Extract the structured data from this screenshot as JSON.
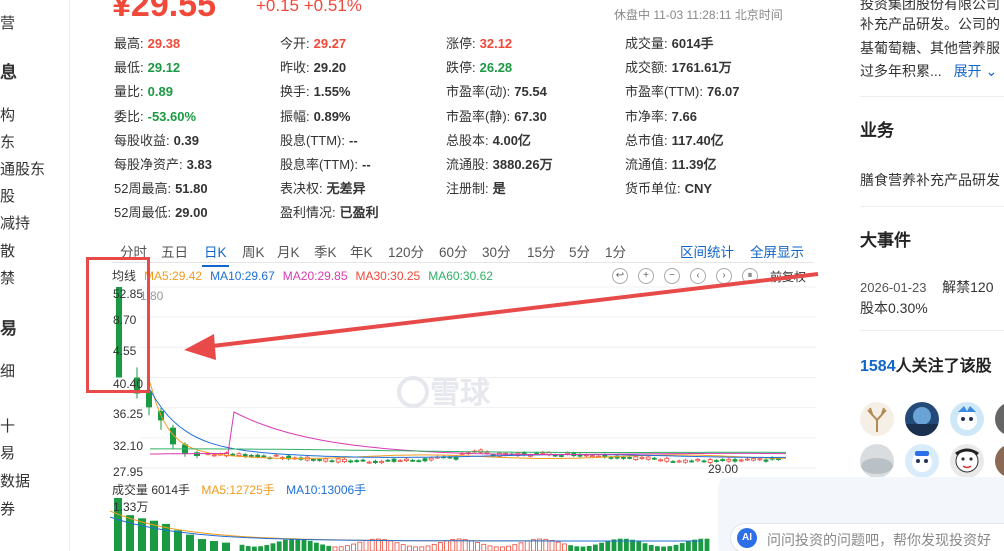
{
  "leftnav": {
    "items": [
      "营",
      "息",
      "构",
      "东",
      "通股东",
      "股",
      "减持",
      "散",
      "禁",
      "易",
      "细",
      "十",
      "易",
      "数据",
      "券"
    ]
  },
  "header": {
    "price": "¥29.55",
    "change": "+0.15  +0.51%",
    "status": "休盘中 11-03 11:28:11 北京时间"
  },
  "quote": {
    "col1": [
      {
        "k": "最高:",
        "v": "29.38",
        "c": "red"
      },
      {
        "k": "最低:",
        "v": "29.12",
        "c": "green"
      },
      {
        "k": "量比:",
        "v": "0.89",
        "c": "green"
      },
      {
        "k": "委比:",
        "v": "-53.60%",
        "c": "green"
      },
      {
        "k": "每股收益:",
        "v": "0.39",
        "c": ""
      },
      {
        "k": "每股净资产:",
        "v": "3.83",
        "c": ""
      },
      {
        "k": "52周最高:",
        "v": "51.80",
        "c": ""
      },
      {
        "k": "52周最低:",
        "v": "29.00",
        "c": ""
      }
    ],
    "col2": [
      {
        "k": "今开:",
        "v": "29.27",
        "c": "red"
      },
      {
        "k": "昨收:",
        "v": "29.20",
        "c": ""
      },
      {
        "k": "换手:",
        "v": "1.55%",
        "c": ""
      },
      {
        "k": "振幅:",
        "v": "0.89%",
        "c": ""
      },
      {
        "k": "股息(TTM):",
        "v": "--",
        "c": ""
      },
      {
        "k": "股息率(TTM):",
        "v": "--",
        "c": ""
      },
      {
        "k": "表决权:",
        "v": "无差异",
        "c": ""
      },
      {
        "k": "盈利情况:",
        "v": "已盈利",
        "c": ""
      }
    ],
    "col3": [
      {
        "k": "涨停:",
        "v": "32.12",
        "c": "red"
      },
      {
        "k": "跌停:",
        "v": "26.28",
        "c": "green"
      },
      {
        "k": "市盈率(动):",
        "v": "75.54",
        "c": ""
      },
      {
        "k": "市盈率(静):",
        "v": "67.30",
        "c": ""
      },
      {
        "k": "总股本:",
        "v": "4.00亿",
        "c": ""
      },
      {
        "k": "流通股:",
        "v": "3880.26万",
        "c": ""
      },
      {
        "k": "注册制:",
        "v": "是",
        "c": ""
      }
    ],
    "col4": [
      {
        "k": "成交量:",
        "v": "6014手",
        "c": ""
      },
      {
        "k": "成交额:",
        "v": "1761.61万",
        "c": ""
      },
      {
        "k": "市盈率(TTM):",
        "v": "76.07",
        "c": ""
      },
      {
        "k": "市净率:",
        "v": "7.66",
        "c": ""
      },
      {
        "k": "总市值:",
        "v": "117.40亿",
        "c": ""
      },
      {
        "k": "流通值:",
        "v": "11.39亿",
        "c": ""
      },
      {
        "k": "货币单位:",
        "v": "CNY",
        "c": ""
      }
    ]
  },
  "tabs": [
    "分时",
    "五日",
    "日K",
    "周K",
    "月K",
    "季K",
    "年K",
    "120分",
    "60分",
    "30分",
    "15分",
    "5分",
    "1分"
  ],
  "active_tab": "日K",
  "tab_links": [
    "区间统计",
    "全屏显示"
  ],
  "ma": {
    "label": "均线",
    "items": [
      {
        "t": "MA5:29.42",
        "c": "#f29b1d"
      },
      {
        "t": "MA10:29.67",
        "c": "#1f6fd8"
      },
      {
        "t": "MA20:29.85",
        "c": "#d83ab3"
      },
      {
        "t": "MA30:30.25",
        "c": "#f0493a"
      },
      {
        "t": "MA60:30.62",
        "c": "#2fb065"
      }
    ]
  },
  "tools": [
    "↩",
    "+",
    "−",
    "‹",
    "›",
    "⏸"
  ],
  "restore": "前复权",
  "y_labels": [
    "52.85",
    "8.70",
    "4.55",
    "40.40",
    "36.25",
    "32.10",
    "27.95"
  ],
  "y_overlap": "1.80",
  "low_marker": "29.00",
  "watermark": "雪球",
  "volume": {
    "title": "成交量 6014手",
    "ma5": "MA5:12725手",
    "ma10": "MA10:13006手",
    "top": "1.33万"
  },
  "right": {
    "intro1": "投资集团股份有限公司",
    "intro2": "补充产品研发。公司的",
    "intro3": "基葡萄糖、其他营养服",
    "intro4": "过多年积累...",
    "expand": "展开",
    "biz_title": "业务",
    "biz_text": "膳食营养补充产品研发",
    "event_title": "大事件",
    "event_date": "2026-01-23",
    "event_text": "解禁120",
    "event_text2": "股本0.30%",
    "followers_count": "1584",
    "followers_text": "人关注了该股"
  },
  "ask": {
    "badge": "AI",
    "placeholder": "问问投资的问题吧，帮你发现投资好"
  },
  "chart_data": {
    "type": "candlestick",
    "ylim": [
      27.95,
      52.85
    ],
    "candles": [
      {
        "o": 40.4,
        "c": 52.85,
        "h": 52.85,
        "l": 40.4,
        "up": false
      },
      {
        "o": 40.4,
        "c": 38.2,
        "h": 41.8,
        "l": 37.5,
        "up": false
      },
      {
        "o": 38.5,
        "c": 36.3,
        "h": 38.9,
        "l": 35.2,
        "up": false
      },
      {
        "o": 35.8,
        "c": 34.5,
        "h": 36.2,
        "l": 33.2,
        "up": false
      },
      {
        "o": 33.5,
        "c": 31.2,
        "h": 33.9,
        "l": 30.6,
        "up": false
      },
      {
        "o": 31.2,
        "c": 29.9,
        "h": 31.5,
        "l": 29.5,
        "up": false
      },
      {
        "o": 30.1,
        "c": 29.6,
        "h": 30.3,
        "l": 29.3,
        "up": false
      }
    ],
    "volume_max": 13300
  }
}
